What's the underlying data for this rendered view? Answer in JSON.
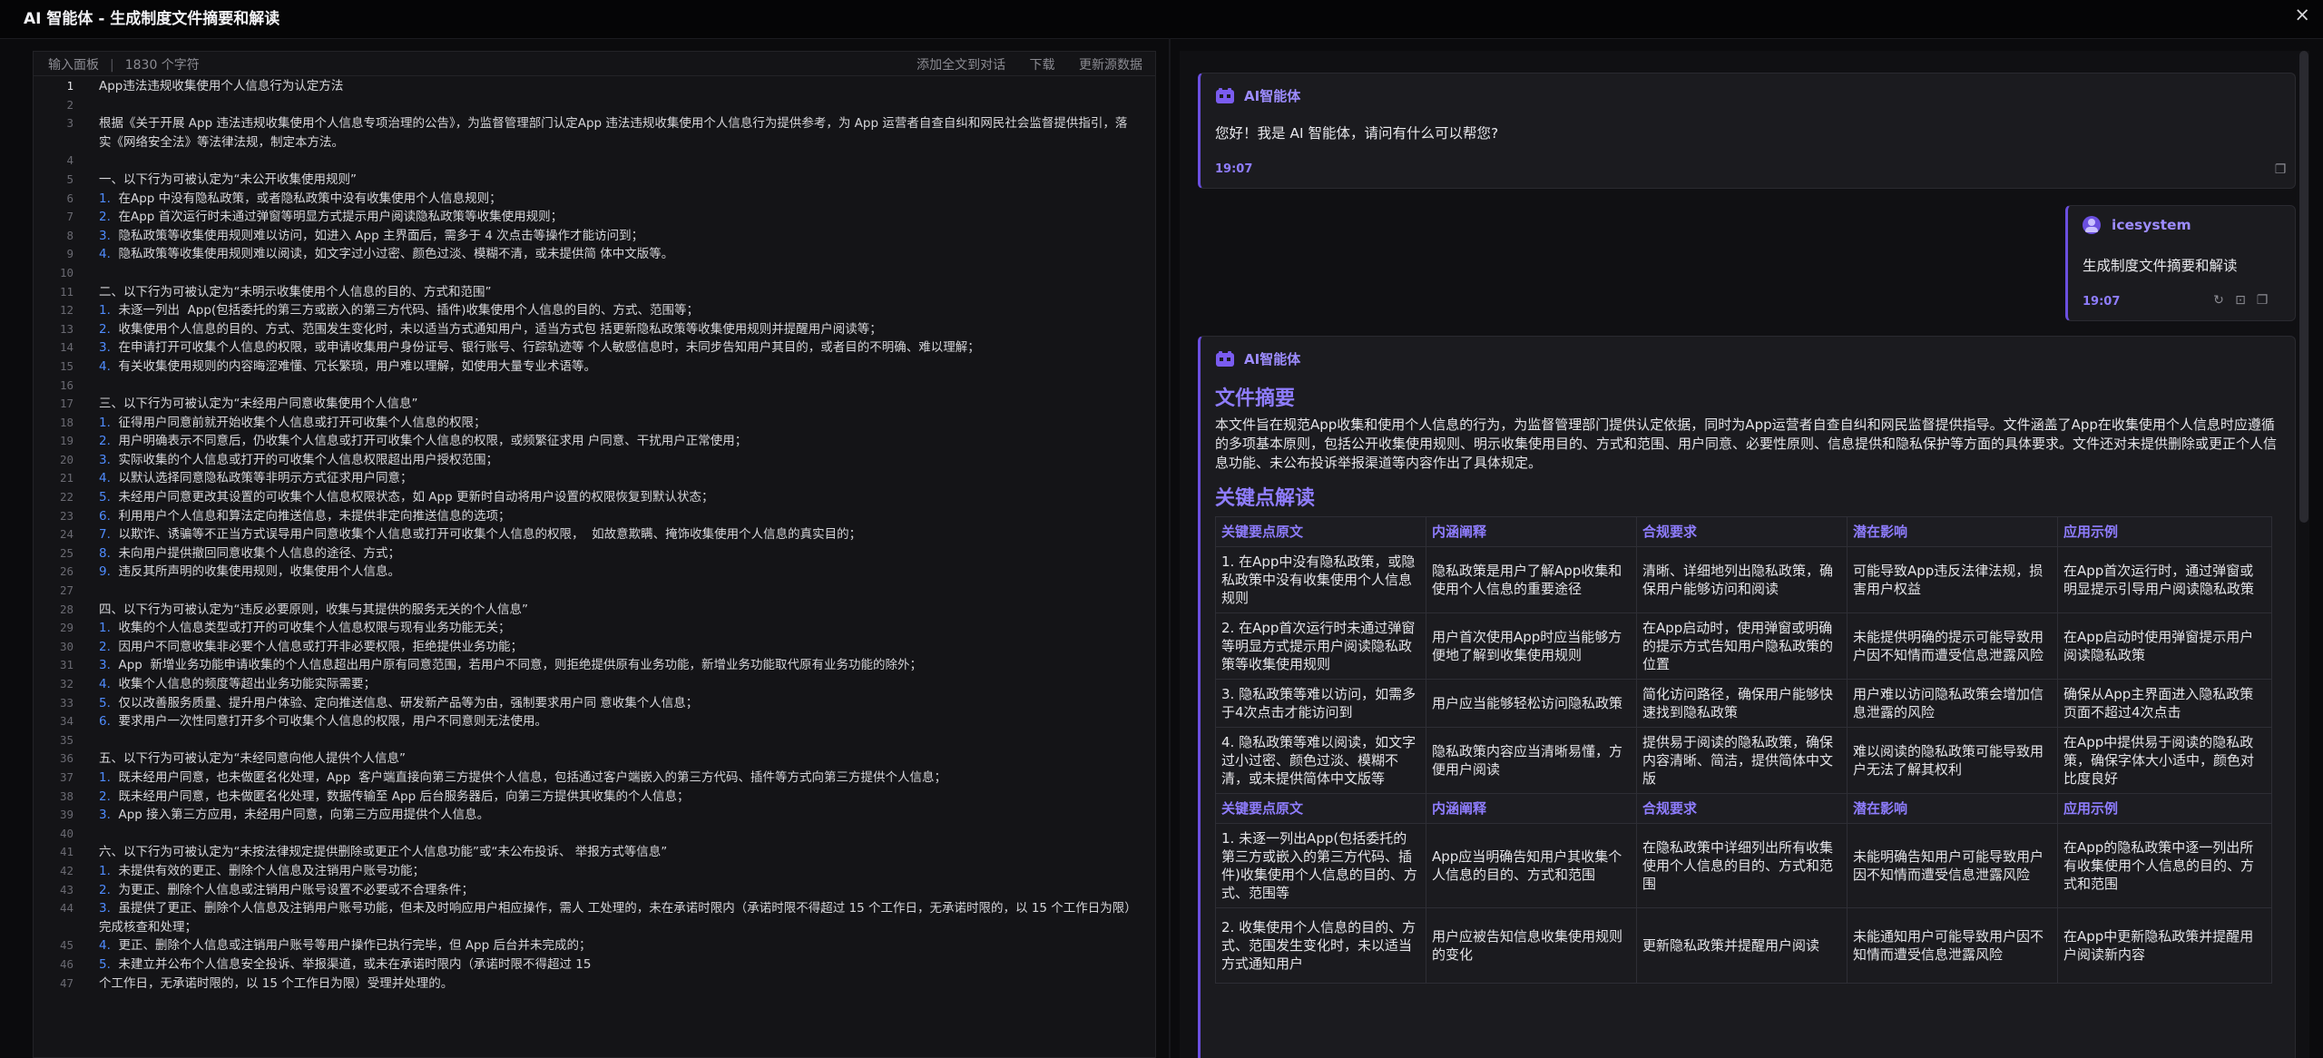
{
  "window": {
    "title": "AI 智能体 - 生成制度文件摘要和解读",
    "close": "×"
  },
  "editor": {
    "panel_label": "输入面板",
    "char_count": "1830 个字符",
    "actions": [
      "添加全文到对话",
      "下载",
      "更新源数据"
    ],
    "lines": [
      {
        "n": "1",
        "t": "App违法违规收集使用个人信息行为认定方法"
      },
      {
        "n": "2",
        "t": ""
      },
      {
        "n": "3",
        "t": "根据《关于开展 App 违法违规收集使用个人信息专项治理的公告》，为监督管理部门认定App 违法违规收集使用个人信息行为提供参考，为 App 运营者自查自纠和网民社会监督提供指引，落实《网络安全法》等法律法规，制定本方法。"
      },
      {
        "n": "4",
        "t": ""
      },
      {
        "n": "5",
        "t": "一、以下行为可被认定为“未公开收集使用规则”"
      },
      {
        "n": "6",
        "p": "1.",
        "t": "在App 中没有隐私政策，或者隐私政策中没有收集使用个人信息规则；"
      },
      {
        "n": "7",
        "p": "2.",
        "t": "在App 首次运行时未通过弹窗等明显方式提示用户阅读隐私政策等收集使用规则；"
      },
      {
        "n": "8",
        "p": "3.",
        "t": "隐私政策等收集使用规则难以访问，如进入 App 主界面后，需多于 4 次点击等操作才能访问到；"
      },
      {
        "n": "9",
        "p": "4.",
        "t": "隐私政策等收集使用规则难以阅读，如文字过小过密、颜色过淡、模糊不清，或未提供简 体中文版等。"
      },
      {
        "n": "10",
        "t": ""
      },
      {
        "n": "11",
        "t": "二、以下行为可被认定为“未明示收集使用个人信息的目的、方式和范围”"
      },
      {
        "n": "12",
        "p": "1.",
        "t": "未逐一列出  App(包括委托的第三方或嵌入的第三方代码、插件)收集使用个人信息的目的、方式、范围等；"
      },
      {
        "n": "13",
        "p": "2.",
        "t": "收集使用个人信息的目的、方式、范围发生变化时，未以适当方式通知用户，适当方式包 括更新隐私政策等收集使用规则并提醒用户阅读等；"
      },
      {
        "n": "14",
        "p": "3.",
        "t": "在申请打开可收集个人信息的权限，或申请收集用户身份证号、银行账号、行踪轨迹等 个人敏感信息时，未同步告知用户其目的，或者目的不明确、难以理解；"
      },
      {
        "n": "15",
        "p": "4.",
        "t": "有关收集使用规则的内容晦涩难懂、冗长繁琐，用户难以理解，如使用大量专业术语等。"
      },
      {
        "n": "16",
        "t": ""
      },
      {
        "n": "17",
        "t": "三、以下行为可被认定为“未经用户同意收集使用个人信息”"
      },
      {
        "n": "18",
        "p": "1.",
        "t": "征得用户同意前就开始收集个人信息或打开可收集个人信息的权限；"
      },
      {
        "n": "19",
        "p": "2.",
        "t": "用户明确表示不同意后，仍收集个人信息或打开可收集个人信息的权限，或频繁征求用 户同意、干扰用户正常使用；"
      },
      {
        "n": "20",
        "p": "3.",
        "t": "实际收集的个人信息或打开的可收集个人信息权限超出用户授权范围；"
      },
      {
        "n": "21",
        "p": "4.",
        "t": "以默认选择同意隐私政策等非明示方式征求用户同意；"
      },
      {
        "n": "22",
        "p": "5.",
        "t": "未经用户同意更改其设置的可收集个人信息权限状态，如 App 更新时自动将用户设置的权限恢复到默认状态；"
      },
      {
        "n": "23",
        "p": "6.",
        "t": "利用用户个人信息和算法定向推送信息，未提供非定向推送信息的选项；"
      },
      {
        "n": "24",
        "p": "7.",
        "t": "以欺诈、诱骗等不正当方式误导用户同意收集个人信息或打开可收集个人信息的权限，  如故意欺瞒、掩饰收集使用个人信息的真实目的；"
      },
      {
        "n": "25",
        "p": "8.",
        "t": "未向用户提供撤回同意收集个人信息的途径、方式；"
      },
      {
        "n": "26",
        "p": "9.",
        "t": "违反其所声明的收集使用规则，收集使用个人信息。"
      },
      {
        "n": "27",
        "t": ""
      },
      {
        "n": "28",
        "t": "四、以下行为可被认定为“违反必要原则，收集与其提供的服务无关的个人信息”"
      },
      {
        "n": "29",
        "p": "1.",
        "t": "收集的个人信息类型或打开的可收集个人信息权限与现有业务功能无关；"
      },
      {
        "n": "30",
        "p": "2.",
        "t": "因用户不同意收集非必要个人信息或打开非必要权限，拒绝提供业务功能；"
      },
      {
        "n": "31",
        "p": "3.",
        "t": "App  新增业务功能申请收集的个人信息超出用户原有同意范围，若用户不同意，则拒绝提供原有业务功能，新增业务功能取代原有业务功能的除外；"
      },
      {
        "n": "32",
        "p": "4.",
        "t": "收集个人信息的频度等超出业务功能实际需要；"
      },
      {
        "n": "33",
        "p": "5.",
        "t": "仅以改善服务质量、提升用户体验、定向推送信息、研发新产品等为由，强制要求用户同 意收集个人信息；"
      },
      {
        "n": "34",
        "p": "6.",
        "t": "要求用户一次性同意打开多个可收集个人信息的权限，用户不同意则无法使用。"
      },
      {
        "n": "35",
        "t": ""
      },
      {
        "n": "36",
        "t": "五、以下行为可被认定为“未经同意向他人提供个人信息”"
      },
      {
        "n": "37",
        "p": "1.",
        "t": "既未经用户同意，也未做匿名化处理，App  客户端直接向第三方提供个人信息，包括通过客户端嵌入的第三方代码、插件等方式向第三方提供个人信息；"
      },
      {
        "n": "38",
        "p": "2.",
        "t": "既未经用户同意，也未做匿名化处理，数据传输至 App 后台服务器后，向第三方提供其收集的个人信息；"
      },
      {
        "n": "39",
        "p": "3.",
        "t": "App 接入第三方应用，未经用户同意，向第三方应用提供个人信息。"
      },
      {
        "n": "40",
        "t": ""
      },
      {
        "n": "41",
        "t": "六、以下行为可被认定为“未按法律规定提供删除或更正个人信息功能”或“未公布投诉、 举报方式等信息”"
      },
      {
        "n": "42",
        "p": "1.",
        "t": "未提供有效的更正、删除个人信息及注销用户账号功能；"
      },
      {
        "n": "43",
        "p": "2.",
        "t": "为更正、删除个人信息或注销用户账号设置不必要或不合理条件；"
      },
      {
        "n": "44",
        "p": "3.",
        "t": "虽提供了更正、删除个人信息及注销用户账号功能，但未及时响应用户相应操作，需人 工处理的，未在承诺时限内（承诺时限不得超过 15 个工作日，无承诺时限的，以 15 个工作日为限）完成核查和处理；"
      },
      {
        "n": "45",
        "p": "4.",
        "t": "更正、删除个人信息或注销用户账号等用户操作已执行完毕，但 App 后台并未完成的；"
      },
      {
        "n": "46",
        "p": "5.",
        "t": "未建立并公布个人信息安全投诉、举报渠道，或未在承诺时限内（承诺时限不得超过 15"
      },
      {
        "n": "47",
        "t": "个工作日，无承诺时限的，以 15 个工作日为限）受理并处理的。"
      }
    ]
  },
  "chat": {
    "ai_name": "AI智能体",
    "greeting": "您好！我是 AI 智能体，请问有什么可以帮您?",
    "greeting_time": "19:07",
    "user_name": "icesystem",
    "user_message": "生成制度文件摘要和解读",
    "user_time": "19:07",
    "answer": {
      "summary_heading": "文件摘要",
      "summary": "本文件旨在规范App收集和使用个人信息的行为，为监督管理部门提供认定依据，同时为App运营者自查自纠和网民监督提供指导。文件涵盖了App在收集使用个人信息时应遵循的多项基本原则，包括公开收集使用规则、明示收集使用目的、方式和范围、用户同意、必要性原则、信息提供和隐私保护等方面的具体要求。文件还对未提供删除或更正个人信息功能、未公布投诉举报渠道等内容作出了具体规定。",
      "analysis_heading": "关键点解读",
      "columns": [
        "关键要点原文",
        "内涵阐释",
        "合规要求",
        "潜在影响",
        "应用示例"
      ],
      "rows": [
        [
          "1. 在App中没有隐私政策，或隐私政策中没有收集使用个人信息规则",
          "隐私政策是用户了解App收集和使用个人信息的重要途径",
          "清晰、详细地列出隐私政策，确保用户能够访问和阅读",
          "可能导致App违反法律法规，损害用户权益",
          "在App首次运行时，通过弹窗或明显提示引导用户阅读隐私政策"
        ],
        [
          "2. 在App首次运行时未通过弹窗等明显方式提示用户阅读隐私政策等收集使用规则",
          "用户首次使用App时应当能够方便地了解到收集使用规则",
          "在App启动时，使用弹窗或明确的提示方式告知用户隐私政策的位置",
          "未能提供明确的提示可能导致用户因不知情而遭受信息泄露风险",
          "在App启动时使用弹窗提示用户阅读隐私政策"
        ],
        [
          "3. 隐私政策等难以访问，如需多于4次点击才能访问到",
          "用户应当能够轻松访问隐私政策",
          "简化访问路径，确保用户能够快速找到隐私政策",
          "用户难以访问隐私政策会增加信息泄露的风险",
          "确保从App主界面进入隐私政策页面不超过4次点击"
        ],
        [
          "4. 隐私政策等难以阅读，如文字过小过密、颜色过淡、模糊不清，或未提供简体中文版等",
          "隐私政策内容应当清晰易懂，方便用户阅读",
          "提供易于阅读的隐私政策，确保内容清晰、简洁，提供简体中文版",
          "难以阅读的隐私政策可能导致用户无法了解其权利",
          "在App中提供易于阅读的隐私政策，确保字体大小适中，颜色对比度良好"
        ]
      ],
      "rows2": [
        [
          "1. 未逐一列出App(包括委托的第三方或嵌入的第三方代码、插件)收集使用个人信息的目的、方式、范围等",
          "App应当明确告知用户其收集个人信息的目的、方式和范围",
          "在隐私政策中详细列出所有收集使用个人信息的目的、方式和范围",
          "未能明确告知用户可能导致用户因不知情而遭受信息泄露风险",
          "在App的隐私政策中逐一列出所有收集使用个人信息的目的、方式和范围"
        ],
        [
          "2. 收集使用个人信息的目的、方式、范围发生变化时，未以适当方式通知用户",
          "用户应被告知信息收集使用规则的变化",
          "更新隐私政策并提醒用户阅读",
          "未能通知用户可能导致用户因不知情而遭受信息泄露风险",
          "在App中更新隐私政策并提醒用户阅读新内容"
        ]
      ]
    }
  }
}
